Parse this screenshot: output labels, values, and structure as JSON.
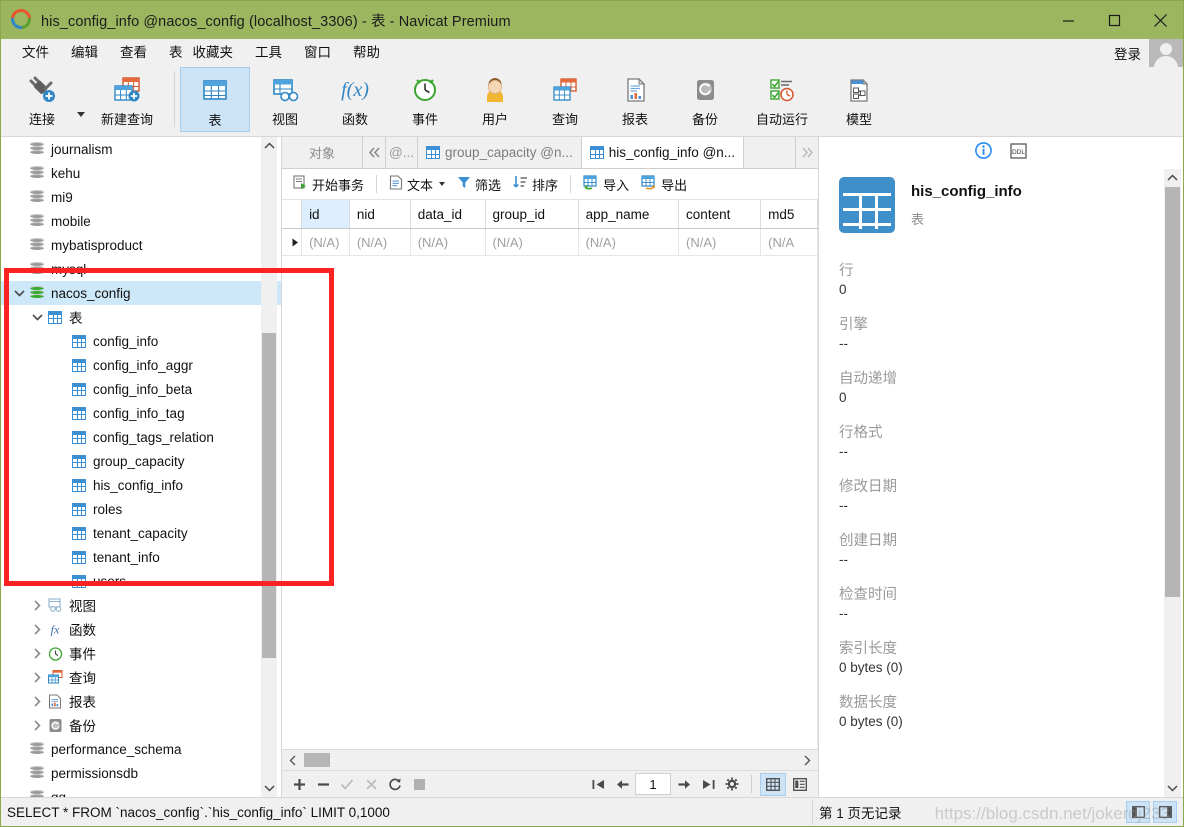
{
  "window": {
    "title": "his_config_info @nacos_config (localhost_3306) - 表 - Navicat Premium",
    "titlebar_color": "#9cb660",
    "minimize_label": "最小化",
    "maximize_label": "最大化",
    "close_label": "关闭"
  },
  "menubar": {
    "items": [
      "文件",
      "编辑",
      "查看",
      "表",
      "收藏夹",
      "工具",
      "窗口",
      "帮助"
    ],
    "login_label": "登录"
  },
  "ribbon": {
    "items": [
      {
        "label": "连接",
        "icon": "connection-icon",
        "active": false,
        "has_dropdown": true
      },
      {
        "label": "新建查询",
        "icon": "new-query-icon",
        "active": false
      },
      {
        "label": "表",
        "icon": "table-icon",
        "active": true
      },
      {
        "label": "视图",
        "icon": "view-icon",
        "active": false
      },
      {
        "label": "函数",
        "icon": "function-icon",
        "active": false
      },
      {
        "label": "事件",
        "icon": "event-icon",
        "active": false
      },
      {
        "label": "用户",
        "icon": "user-icon",
        "active": false
      },
      {
        "label": "查询",
        "icon": "query-icon",
        "active": false
      },
      {
        "label": "报表",
        "icon": "report-icon",
        "active": false
      },
      {
        "label": "备份",
        "icon": "backup-icon",
        "active": false
      },
      {
        "label": "自动运行",
        "icon": "automation-icon",
        "active": false
      },
      {
        "label": "模型",
        "icon": "model-icon",
        "active": false
      }
    ]
  },
  "sidebar": {
    "nodes": [
      {
        "label": "journalism",
        "type": "database",
        "indent": 0,
        "twist": "none",
        "selected": false
      },
      {
        "label": "kehu",
        "type": "database",
        "indent": 0,
        "twist": "none",
        "selected": false
      },
      {
        "label": "mi9",
        "type": "database",
        "indent": 0,
        "twist": "none",
        "selected": false
      },
      {
        "label": "mobile",
        "type": "database",
        "indent": 0,
        "twist": "none",
        "selected": false
      },
      {
        "label": "mybatisproduct",
        "type": "database",
        "indent": 0,
        "twist": "none",
        "selected": false
      },
      {
        "label": "mysql",
        "type": "database",
        "indent": 0,
        "twist": "none",
        "selected": false
      },
      {
        "label": "nacos_config",
        "type": "database-open",
        "indent": 0,
        "twist": "down",
        "selected": true
      },
      {
        "label": "表",
        "type": "table-folder",
        "indent": 1,
        "twist": "down",
        "selected": false
      },
      {
        "label": "config_info",
        "type": "table",
        "indent": 2,
        "twist": "none",
        "selected": false
      },
      {
        "label": "config_info_aggr",
        "type": "table",
        "indent": 2,
        "twist": "none",
        "selected": false
      },
      {
        "label": "config_info_beta",
        "type": "table",
        "indent": 2,
        "twist": "none",
        "selected": false
      },
      {
        "label": "config_info_tag",
        "type": "table",
        "indent": 2,
        "twist": "none",
        "selected": false
      },
      {
        "label": "config_tags_relation",
        "type": "table",
        "indent": 2,
        "twist": "none",
        "selected": false
      },
      {
        "label": "group_capacity",
        "type": "table",
        "indent": 2,
        "twist": "none",
        "selected": false
      },
      {
        "label": "his_config_info",
        "type": "table",
        "indent": 2,
        "twist": "none",
        "selected": false
      },
      {
        "label": "roles",
        "type": "table",
        "indent": 2,
        "twist": "none",
        "selected": false
      },
      {
        "label": "tenant_capacity",
        "type": "table",
        "indent": 2,
        "twist": "none",
        "selected": false
      },
      {
        "label": "tenant_info",
        "type": "table",
        "indent": 2,
        "twist": "none",
        "selected": false
      },
      {
        "label": "users",
        "type": "table",
        "indent": 2,
        "twist": "none",
        "selected": false
      },
      {
        "label": "视图",
        "type": "view-folder",
        "indent": 1,
        "twist": "right",
        "selected": false
      },
      {
        "label": "函数",
        "type": "function-folder",
        "indent": 1,
        "twist": "right",
        "selected": false
      },
      {
        "label": "事件",
        "type": "event-folder",
        "indent": 1,
        "twist": "right",
        "selected": false
      },
      {
        "label": "查询",
        "type": "query-folder",
        "indent": 1,
        "twist": "right",
        "selected": false
      },
      {
        "label": "报表",
        "type": "report-folder",
        "indent": 1,
        "twist": "right",
        "selected": false
      },
      {
        "label": "备份",
        "type": "backup-folder",
        "indent": 1,
        "twist": "right",
        "selected": false
      },
      {
        "label": "performance_schema",
        "type": "database",
        "indent": 0,
        "twist": "none",
        "selected": false
      },
      {
        "label": "permissionsdb",
        "type": "database",
        "indent": 0,
        "twist": "none",
        "selected": false
      },
      {
        "label": "qq",
        "type": "database",
        "indent": 0,
        "twist": "none",
        "selected": false
      }
    ]
  },
  "annotation": {
    "color": "#fb2222",
    "note": "red highlight rectangle around nacos_config tables"
  },
  "tabs": {
    "object_label": "对象",
    "prev_icon": "chevron-left-double-icon",
    "next_icon": "chevron-right-double-icon",
    "items": [
      {
        "label": "@...",
        "active": false,
        "partial": true
      },
      {
        "label": "group_capacity @n...",
        "active": false,
        "partial": false
      },
      {
        "label": "his_config_info @n...",
        "active": true,
        "partial": false
      }
    ]
  },
  "data_toolbar": {
    "items": [
      {
        "label": "开始事务",
        "icon": "begin-transaction-icon"
      },
      {
        "label": "文本",
        "icon": "text-icon",
        "has_dropdown": true
      },
      {
        "label": "筛选",
        "icon": "filter-icon"
      },
      {
        "label": "排序",
        "icon": "sort-icon"
      },
      {
        "label": "导入",
        "icon": "import-icon"
      },
      {
        "label": "导出",
        "icon": "export-icon"
      }
    ]
  },
  "grid": {
    "columns": [
      "id",
      "nid",
      "data_id",
      "group_id",
      "app_name",
      "content",
      "md5"
    ],
    "rows": [
      [
        "(N/A)",
        "(N/A)",
        "(N/A)",
        "(N/A)",
        "(N/A)",
        "(N/A)",
        "(N/A"
      ]
    ]
  },
  "rowbar": {
    "add_label": "添加记录",
    "delete_label": "删除记录",
    "apply_label": "应用改变",
    "cancel_label": "放弃改变",
    "refresh_label": "刷新",
    "stop_label": "停止",
    "first_label": "第一条记录",
    "prev_label": "上一条记录",
    "page_value": "1",
    "next_label": "下一条记录",
    "last_label": "最后一条记录",
    "settings_label": "设置",
    "grid_view_label": "网格查看",
    "form_view_label": "表单查看"
  },
  "info_panel": {
    "info_tab_icon": "info-circle-icon",
    "ddl_tab_icon": "ddl-icon",
    "object_name": "his_config_info",
    "object_type": "表",
    "fields": [
      {
        "key": "行",
        "value": "0"
      },
      {
        "key": "引擎",
        "value": "--"
      },
      {
        "key": "自动递增",
        "value": "0"
      },
      {
        "key": "行格式",
        "value": "--"
      },
      {
        "key": "修改日期",
        "value": "--"
      },
      {
        "key": "创建日期",
        "value": "--"
      },
      {
        "key": "检查时间",
        "value": "--"
      },
      {
        "key": "索引长度",
        "value": "0 bytes (0)"
      },
      {
        "key": "数据长度",
        "value": "0 bytes (0)"
      }
    ]
  },
  "statusbar": {
    "sql": "SELECT * FROM `nacos_config`.`his_config_info` LIMIT 0,1000",
    "pages": "第 1 页无记录",
    "left_toggle_label": "显示/隐藏左侧面板",
    "right_toggle_label": "显示/隐藏右侧面板"
  },
  "watermark": "https://blog.csdn.net/jokerdj233"
}
